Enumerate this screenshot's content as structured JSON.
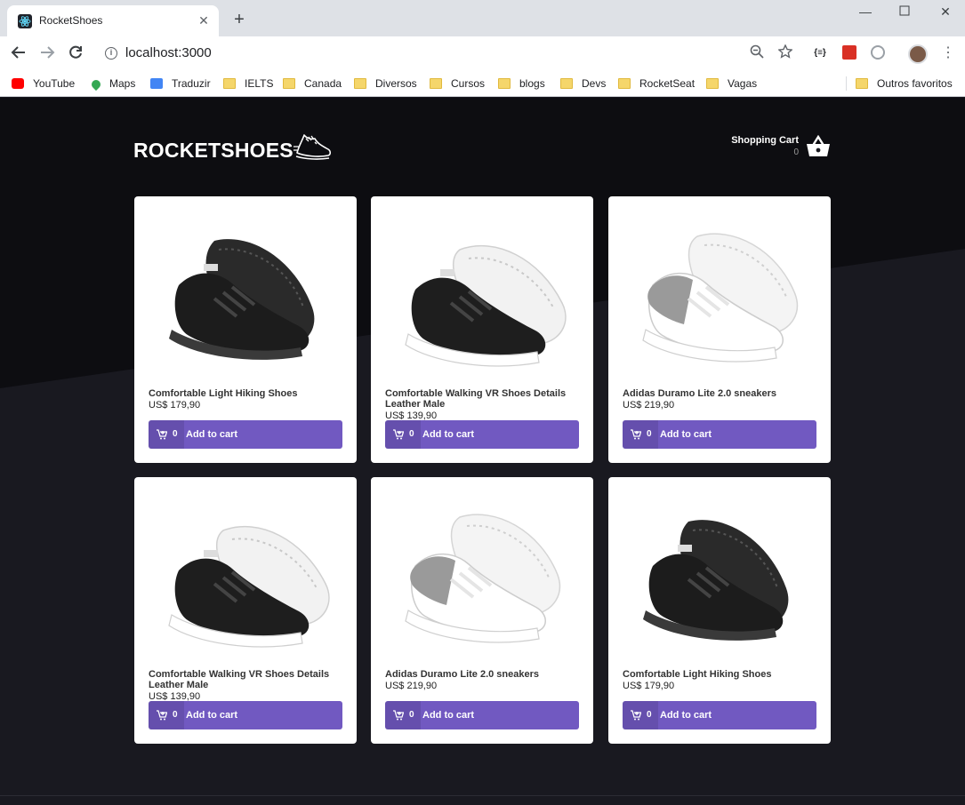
{
  "browser": {
    "tab_title": "RocketShoes",
    "url": "localhost:3000",
    "bookmarks": [
      "YouTube",
      "Maps",
      "Traduzir",
      "IELTS",
      "Canada",
      "Diversos",
      "Cursos",
      "blogs",
      "Devs",
      "RocketSeat",
      "Vagas"
    ],
    "other_bookmarks": "Outros favoritos",
    "extension_label": "{≡}"
  },
  "header": {
    "logo_text": "ROCKETSHOES",
    "cart_title": "Shopping Cart",
    "cart_count": "0"
  },
  "products": [
    {
      "title": "Comfortable Light Hiking Shoes",
      "price": "US$ 179,90",
      "count": "0",
      "button_label": "Add to cart",
      "shoe": "black"
    },
    {
      "title": "Comfortable Walking VR Shoes Details Leather Male",
      "price": "US$ 139,90",
      "count": "0",
      "button_label": "Add to cart",
      "shoe": "black-white"
    },
    {
      "title": "Adidas Duramo Lite 2.0 sneakers",
      "price": "US$ 219,90",
      "count": "0",
      "button_label": "Add to cart",
      "shoe": "white-grey"
    },
    {
      "title": "Comfortable Walking VR Shoes Details Leather Male",
      "price": "US$ 139,90",
      "count": "0",
      "button_label": "Add to cart",
      "shoe": "black-white"
    },
    {
      "title": "Adidas Duramo Lite 2.0 sneakers",
      "price": "US$ 219,90",
      "count": "0",
      "button_label": "Add to cart",
      "shoe": "white-grey"
    },
    {
      "title": "Comfortable Light Hiking Shoes",
      "price": "US$ 179,90",
      "count": "0",
      "button_label": "Add to cart",
      "shoe": "black"
    }
  ],
  "colors": {
    "primary": "#7159c1",
    "background": "#191920",
    "card": "#ffffff"
  }
}
